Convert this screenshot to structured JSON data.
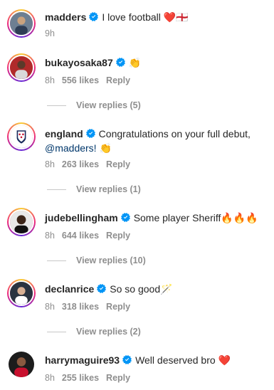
{
  "comments": [
    {
      "username": "madders",
      "text": "I love football",
      "emoji": "❤️🏴󠁧󠁢󠁥󠁮󠁧󠁿",
      "time": "9h",
      "verified": true
    },
    {
      "username": "bukayosaka87",
      "text": "",
      "emoji": "👏",
      "time": "8h",
      "likes": "556 likes",
      "reply": "Reply",
      "view_replies": "View replies (5)",
      "verified": true
    },
    {
      "username": "england",
      "text": "Congratulations on your full debut,",
      "mention": "@madders!",
      "emoji": "👏",
      "time": "8h",
      "likes": "263 likes",
      "reply": "Reply",
      "view_replies": "View replies (1)",
      "verified": true
    },
    {
      "username": "judebellingham",
      "text": "Some player Sheriff",
      "emoji": "🔥🔥🔥",
      "time": "8h",
      "likes": "644 likes",
      "reply": "Reply",
      "view_replies": "View replies (10)",
      "verified": true
    },
    {
      "username": "declanrice",
      "text": "So so good",
      "emoji": "🪄",
      "time": "8h",
      "likes": "318 likes",
      "reply": "Reply",
      "view_replies": "View replies (2)",
      "verified": true
    },
    {
      "username": "harrymaguire93",
      "text": "Well deserved bro",
      "emoji": "❤️",
      "time": "8h",
      "likes": "255 likes",
      "reply": "Reply",
      "verified": true
    }
  ],
  "colors": {
    "verified_blue": "#0095f6",
    "muted": "#8e8e8e",
    "mention": "#00376b"
  }
}
